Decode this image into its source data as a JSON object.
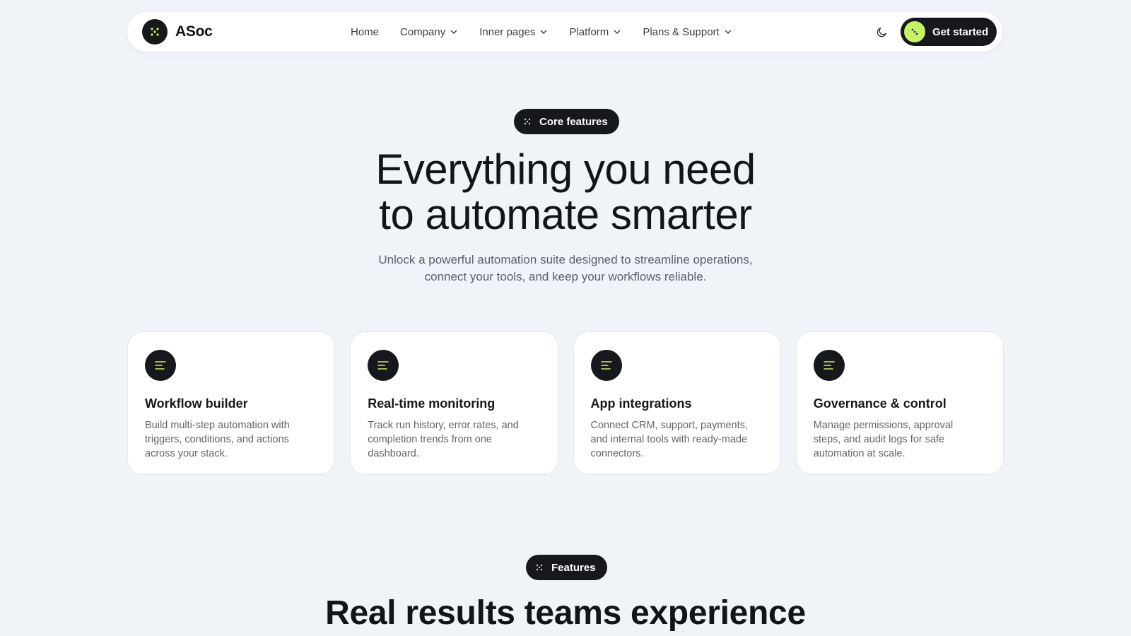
{
  "brand": {
    "name": "ASoc",
    "icon": "dots-logo-icon"
  },
  "nav": {
    "items": [
      {
        "label": "Home",
        "has_dropdown": false
      },
      {
        "label": "Company",
        "has_dropdown": true
      },
      {
        "label": "Inner pages",
        "has_dropdown": true
      },
      {
        "label": "Platform",
        "has_dropdown": true
      },
      {
        "label": "Plans & Support",
        "has_dropdown": true
      }
    ],
    "theme_toggle_icon": "moon-icon",
    "cta_label": "Get started"
  },
  "hero": {
    "badge": "Core features",
    "title_line1": "Everything you need",
    "title_line2": "to automate smarter",
    "subtitle_line1": "Unlock a powerful automation suite designed to streamline operations,",
    "subtitle_line2": "connect your tools, and keep your workflows reliable."
  },
  "features": [
    {
      "title": "Workflow builder",
      "description": "Build multi-step automation with triggers, conditions, and actions across your stack.",
      "icon": "menu-lines-icon"
    },
    {
      "title": "Real-time monitoring",
      "description": "Track run history, error rates, and completion trends from one dashboard.",
      "icon": "menu-lines-icon"
    },
    {
      "title": "App integrations",
      "description": "Connect CRM, support, payments, and internal tools with ready-made connectors.",
      "icon": "menu-lines-icon"
    },
    {
      "title": "Governance & control",
      "description": "Manage permissions, approval steps, and audit logs for safe automation at scale.",
      "icon": "menu-lines-icon"
    }
  ],
  "results": {
    "badge": "Features",
    "title": "Real results teams experience"
  },
  "colors": {
    "background": "#f0f3f8",
    "dark": "#16181c",
    "accent": "#c6f26a"
  }
}
